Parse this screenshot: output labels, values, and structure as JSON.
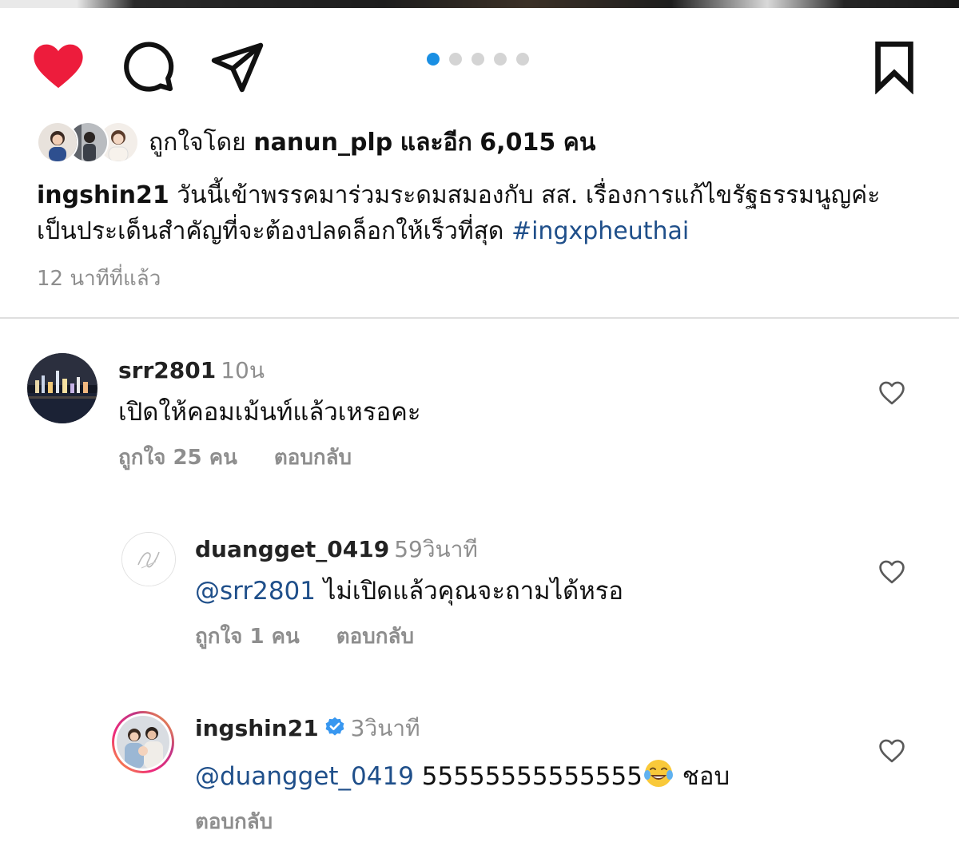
{
  "post": {
    "liked_by_prefix": "ถูกใจโดย",
    "liked_by_user": "nanun_plp",
    "liked_by_and": "และอีก",
    "likes_count": "6,015",
    "likes_unit": "คน",
    "carousel": {
      "total": 5,
      "active": 1
    },
    "caption": {
      "username": "ingshin21",
      "line1": "วันนี้เข้าพรรคมาร่วมระดมสมองกับ สส. เรื่องการแก้ไขรัฐธรรมนูญค่ะ",
      "line2": "เป็นประเด็นสำคัญที่จะต้องปลดล็อกให้เร็วที่สุด",
      "hashtag": "#ingxpheuthai"
    },
    "time_ago": "12 นาทีที่แล้ว"
  },
  "comments": [
    {
      "username": "srr2801",
      "time": "10น",
      "text": "เปิดให้คอมเม้นท์แล้วเหรอคะ",
      "likes": "ถูกใจ 25 คน",
      "reply": "ตอบกลับ"
    },
    {
      "username": "duangget_0419",
      "time": "59วินาที",
      "mention": "@srr2801",
      "text": " ไม่เปิดแล้วคุณจะถามได้หรอ",
      "likes": "ถูกใจ 1 คน",
      "reply": "ตอบกลับ"
    },
    {
      "username": "ingshin21",
      "time": "3วินาที",
      "mention": "@duangget_0419",
      "text": " 55555555555555",
      "text_after": " ชอบ",
      "reply": "ตอบกลับ"
    }
  ],
  "icons": {
    "like": "heart-filled-icon",
    "comment": "comment-bubble-icon",
    "share": "paper-plane-icon",
    "save": "bookmark-icon",
    "comment_like": "heart-outline-icon",
    "verified": "verified-badge-icon",
    "emoji": "tears-of-joy-emoji"
  },
  "colors": {
    "like_red": "#ed1c3c",
    "link_blue": "#1f4f8a",
    "dot_active": "#1a8fe3",
    "muted": "#8e8e8e",
    "verified_blue": "#3897f0"
  }
}
